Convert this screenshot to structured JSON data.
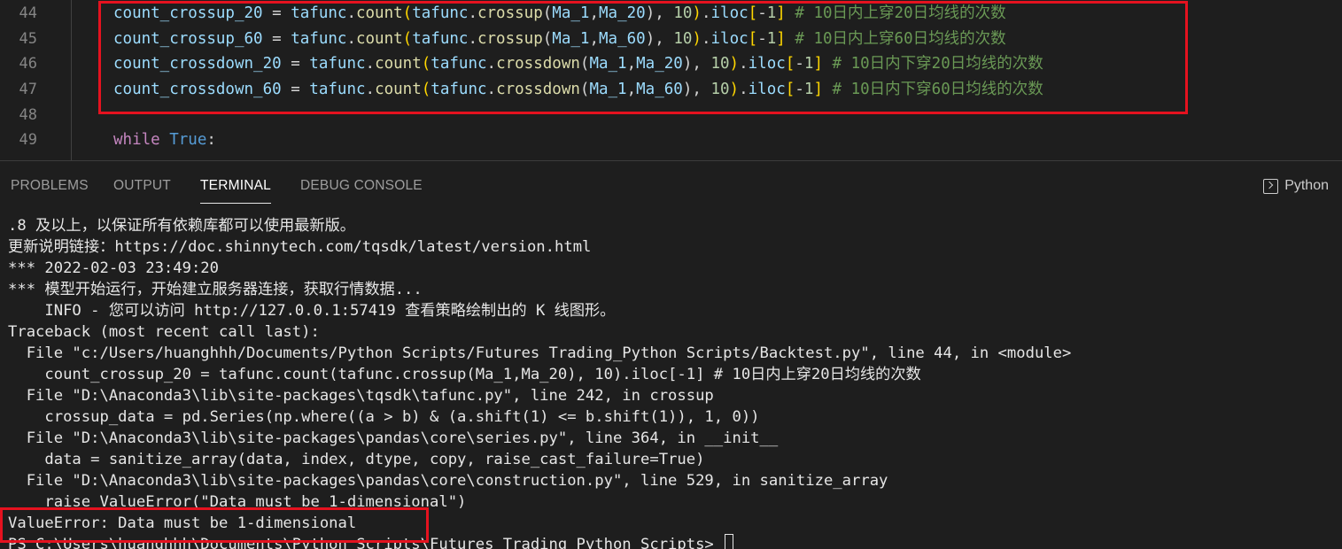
{
  "editor": {
    "lines": [
      {
        "number": "44",
        "code": "count_crossup_20 = tafunc.count(tafunc.crossup(Ma_1,Ma_20), 10).iloc[-1] # 10日内上穿20日均线的次数"
      },
      {
        "number": "45",
        "code": "count_crossup_60 = tafunc.count(tafunc.crossup(Ma_1,Ma_60), 10).iloc[-1] # 10日内上穿60日均线的次数"
      },
      {
        "number": "46",
        "code": "count_crossdown_20 = tafunc.count(tafunc.crossdown(Ma_1,Ma_20), 10).iloc[-1] # 10日内下穿20日均线的次数"
      },
      {
        "number": "47",
        "code": "count_crossdown_60 = tafunc.count(tafunc.crossdown(Ma_1,Ma_60), 10).iloc[-1] # 10日内下穿60日均线的次数"
      },
      {
        "number": "48",
        "code": ""
      },
      {
        "number": "49",
        "code": "while True:"
      }
    ],
    "highlight_color": "#e5121f"
  },
  "panel": {
    "tabs": [
      {
        "label": "PROBLEMS",
        "active": false
      },
      {
        "label": "OUTPUT",
        "active": false
      },
      {
        "label": "TERMINAL",
        "active": true
      },
      {
        "label": "DEBUG CONSOLE",
        "active": false
      }
    ],
    "terminal_type": "Python",
    "terminal_icon": "terminal-icon"
  },
  "terminal": {
    "lines": [
      ".8 及以上，以保证所有依赖库都可以使用最新版。",
      "更新说明链接：https://doc.shinnytech.com/tqsdk/latest/version.html",
      "*** 2022-02-03 23:49:20",
      "*** 模型开始运行，开始建立服务器连接，获取行情数据...",
      "    INFO - 您可以访问 http://127.0.0.1:57419 查看策略绘制出的 K 线图形。",
      "Traceback (most recent call last):",
      "  File \"c:/Users/huanghhh/Documents/Python Scripts/Futures Trading_Python Scripts/Backtest.py\", line 44, in <module>",
      "    count_crossup_20 = tafunc.count(tafunc.crossup(Ma_1,Ma_20), 10).iloc[-1] # 10日内上穿20日均线的次数",
      "  File \"D:\\Anaconda3\\lib\\site-packages\\tqsdk\\tafunc.py\", line 242, in crossup",
      "    crossup_data = pd.Series(np.where((a > b) & (a.shift(1) <= b.shift(1)), 1, 0))",
      "  File \"D:\\Anaconda3\\lib\\site-packages\\pandas\\core\\series.py\", line 364, in __init__",
      "    data = sanitize_array(data, index, dtype, copy, raise_cast_failure=True)",
      "  File \"D:\\Anaconda3\\lib\\site-packages\\pandas\\core\\construction.py\", line 529, in sanitize_array",
      "    raise ValueError(\"Data must be 1-dimensional\")",
      "ValueError: Data must be 1-dimensional",
      "PS C:\\Users\\huanghhh\\Documents\\Python Scripts\\Futures Trading_Python Scripts> "
    ]
  }
}
